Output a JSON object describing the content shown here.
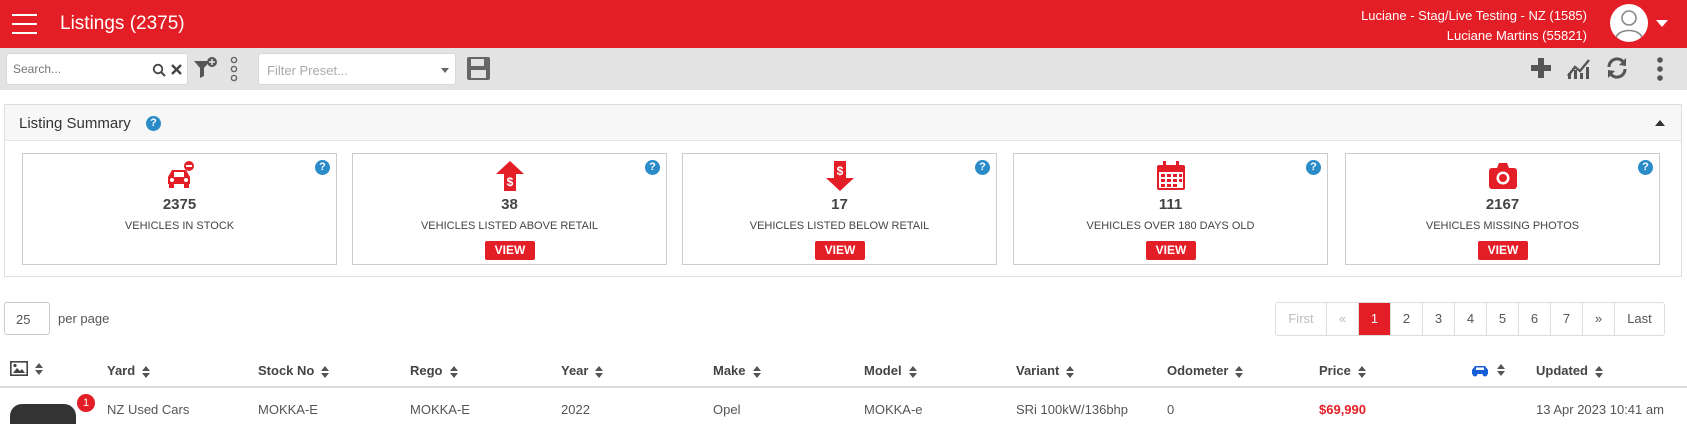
{
  "header": {
    "title": "Listings (2375)",
    "account_line": "Luciane - Stag/Live Testing - NZ (1585)",
    "user_line": "Luciane Martins (55821)",
    "brand_color": "#e41e26"
  },
  "toolbar": {
    "search_placeholder": "Search...",
    "filter_preset_placeholder": "Filter Preset...",
    "icons": [
      "search-icon",
      "clear-icon",
      "filter-add-icon",
      "vertical-dots-icon",
      "save-icon",
      "plus-icon",
      "chart-icon",
      "refresh-icon",
      "more-icon"
    ]
  },
  "summary": {
    "title": "Listing Summary",
    "help": "?",
    "cards": [
      {
        "icon": "car-icon",
        "count": "2375",
        "label": "VEHICLES IN STOCK",
        "view": ""
      },
      {
        "icon": "price-up-icon",
        "count": "38",
        "label": "VEHICLES LISTED ABOVE RETAIL",
        "view": "VIEW"
      },
      {
        "icon": "price-down-icon",
        "count": "17",
        "label": "VEHICLES LISTED BELOW RETAIL",
        "view": "VIEW"
      },
      {
        "icon": "calendar-icon",
        "count": "111",
        "label": "VEHICLES OVER 180 DAYS OLD",
        "view": "VIEW"
      },
      {
        "icon": "camera-icon",
        "count": "2167",
        "label": "VEHICLES MISSING PHOTOS",
        "view": "VIEW"
      }
    ]
  },
  "paging": {
    "per_page_value": "25",
    "per_page_label": "per page",
    "pages": [
      "First",
      "«",
      "1",
      "2",
      "3",
      "4",
      "5",
      "6",
      "7",
      "»",
      "Last"
    ],
    "active_page": "1"
  },
  "table": {
    "columns": [
      "",
      "Yard",
      "Stock No",
      "Rego",
      "Year",
      "Make",
      "Model",
      "Variant",
      "Odometer",
      "Price",
      "",
      "Updated"
    ],
    "rows": [
      {
        "badge": "1",
        "yard": "NZ Used Cars",
        "stock_no": "MOKKA-E",
        "rego": "MOKKA-E",
        "year": "2022",
        "make": "Opel",
        "model": "MOKKA-e",
        "variant": "SRi 100kW/136bhp",
        "odometer": "0",
        "price": "$69,990",
        "updated": "13 Apr 2023 10:41 am"
      }
    ]
  }
}
